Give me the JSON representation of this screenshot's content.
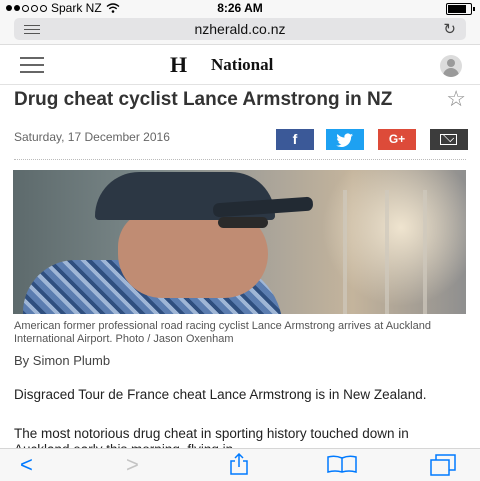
{
  "status_bar": {
    "carrier": "Spark NZ",
    "time": "8:26 AM",
    "battery": 0.9
  },
  "address_bar": {
    "url": "nzherald.co.nz"
  },
  "site_header": {
    "logo": "H",
    "section": "National"
  },
  "article": {
    "headline": "Drug cheat cyclist Lance Armstrong in NZ",
    "date": "Saturday, 17 December 2016",
    "share": {
      "facebook": "f",
      "googleplus": "G+"
    },
    "caption": "American former professional road racing cyclist Lance Armstrong arrives at Auckland International Airport. Photo / Jason Oxenham",
    "byline": "By Simon Plumb",
    "paragraphs": [
      "Disgraced Tour de France cheat Lance Armstrong is in New Zealand.",
      "The most notorious drug cheat in sporting history touched down in Auckland early this morning, flying in"
    ]
  },
  "toolbar": {
    "back": "<",
    "forward": ">"
  }
}
